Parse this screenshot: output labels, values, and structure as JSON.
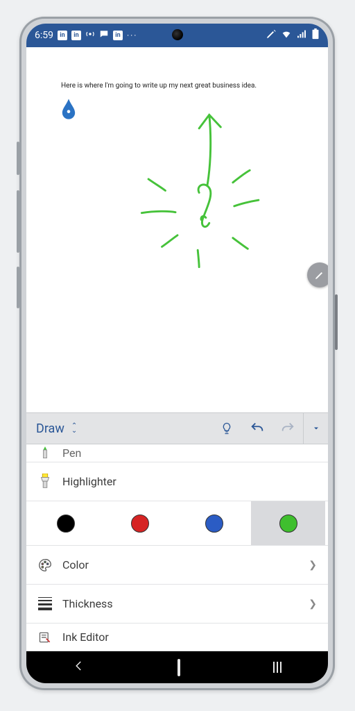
{
  "status": {
    "time": "6:59",
    "dots": "···"
  },
  "document": {
    "text": "Here is where I'm going to write up my next great business idea."
  },
  "ribbon": {
    "tab": "Draw"
  },
  "tools": {
    "pen": "Pen",
    "highlighter": "Highlighter",
    "color": "Color",
    "thickness": "Thickness",
    "ink_editor": "Ink Editor"
  },
  "swatches": {
    "colors": [
      "#000000",
      "#d62424",
      "#2b5cc4",
      "#3fbf2e"
    ],
    "selected_index": 3
  }
}
